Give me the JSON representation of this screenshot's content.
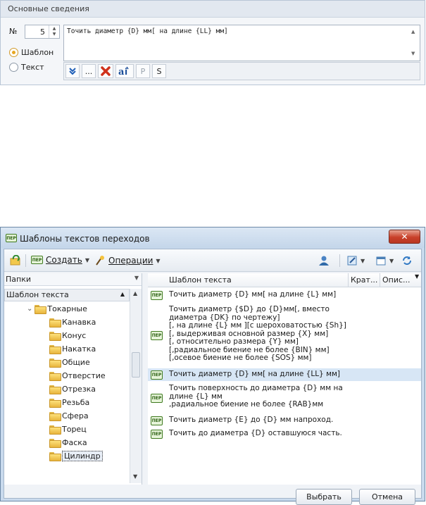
{
  "panel": {
    "header": "Основные сведения",
    "number_label": "№",
    "number_value": "5",
    "template_text": "Точить диаметр {D} мм[ на длине {LL} мм]",
    "radio_template": "Шаблон",
    "radio_text": "Текст",
    "selected_radio": "Шаблон",
    "toolbar": {
      "dots": "...",
      "p": "P",
      "s": "S"
    }
  },
  "dialog": {
    "title": "Шаблоны текстов переходов",
    "toolbar": {
      "create": "Создать",
      "operations": "Операции"
    },
    "folders_label": "Папки",
    "tree_header": "Шаблон текста",
    "tree": {
      "root": "Токарные",
      "children": [
        "Канавка",
        "Конус",
        "Накатка",
        "Общие",
        "Отверстие",
        "Отрезка",
        "Резьба",
        "Сфера",
        "Торец",
        "Фаска",
        "Цилиндр"
      ],
      "selected": "Цилиндр"
    },
    "columns": [
      "Шаблон текста",
      "Крат...",
      "Опис..."
    ],
    "rows": [
      {
        "text": "Точить диаметр {D} мм[ на длине {L} мм]"
      },
      {
        "text": "Точить диаметр {$D} до {D}мм[, вместо\nдиаметра {DK} по чертежу]\n[, на длине {L} мм ][с шероховатостью {Sh}]\n[, выдерживая основной размер {X} мм]\n[, относительно размера {Y} мм]\n[,радиальное биение не более {BIN} мм]\n[,осевое биение не более {SOS} мм]"
      },
      {
        "text": "Точить диаметр {D} мм[ на длине {LL} мм]",
        "selected": true
      },
      {
        "text": "Точить поверхность до диаметра {D} мм на\nдлине {L} мм\n,радиальное биение не более {RAB}мм"
      },
      {
        "text": "Точить диаметр {E} до {D} мм напроход."
      },
      {
        "text": "Точить до диаметра {D} оставшуюся часть."
      }
    ],
    "icon_label": "ПЕР",
    "btn_select": "Выбрать",
    "btn_cancel": "Отмена"
  }
}
